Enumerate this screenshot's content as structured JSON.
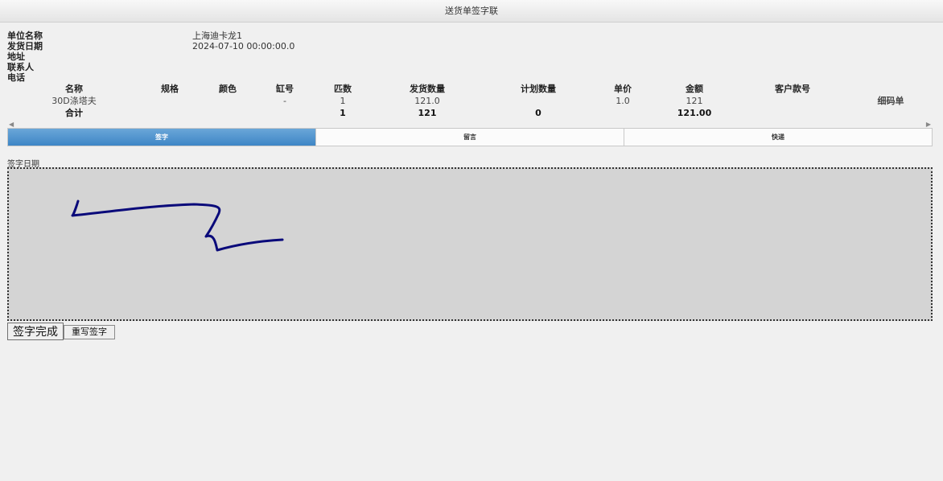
{
  "window": {
    "title": "送货单签字联"
  },
  "info": {
    "labels": [
      "单位名称",
      "发货日期",
      "地址",
      "联系人",
      "电话"
    ],
    "values": [
      "上海迪卡龙1",
      "2024-07-10 00:00:00.0",
      "",
      "",
      ""
    ]
  },
  "table": {
    "headers": [
      "名称",
      "规格",
      "颜色",
      "缸号",
      "匹数",
      "发货数量",
      "计划数量",
      "单价",
      "金额",
      "客户款号"
    ],
    "row": [
      "30D涤塔夫",
      "",
      "",
      "-",
      "1",
      "121.0",
      "",
      "1.0",
      "121",
      ""
    ],
    "detail_link": "细码单",
    "total": [
      "合计",
      "",
      "",
      "",
      "1",
      "121",
      "0",
      "",
      "121.00",
      ""
    ]
  },
  "tabs": [
    {
      "label": "签字",
      "active": true
    },
    {
      "label": "留言",
      "active": false
    },
    {
      "label": "快递",
      "active": false
    }
  ],
  "signature": {
    "label": "签字日期",
    "ink_color": "#0a0a7a",
    "background": "#d4d4d4"
  },
  "buttons": {
    "done": "签字完成",
    "redo": "重写签字"
  }
}
